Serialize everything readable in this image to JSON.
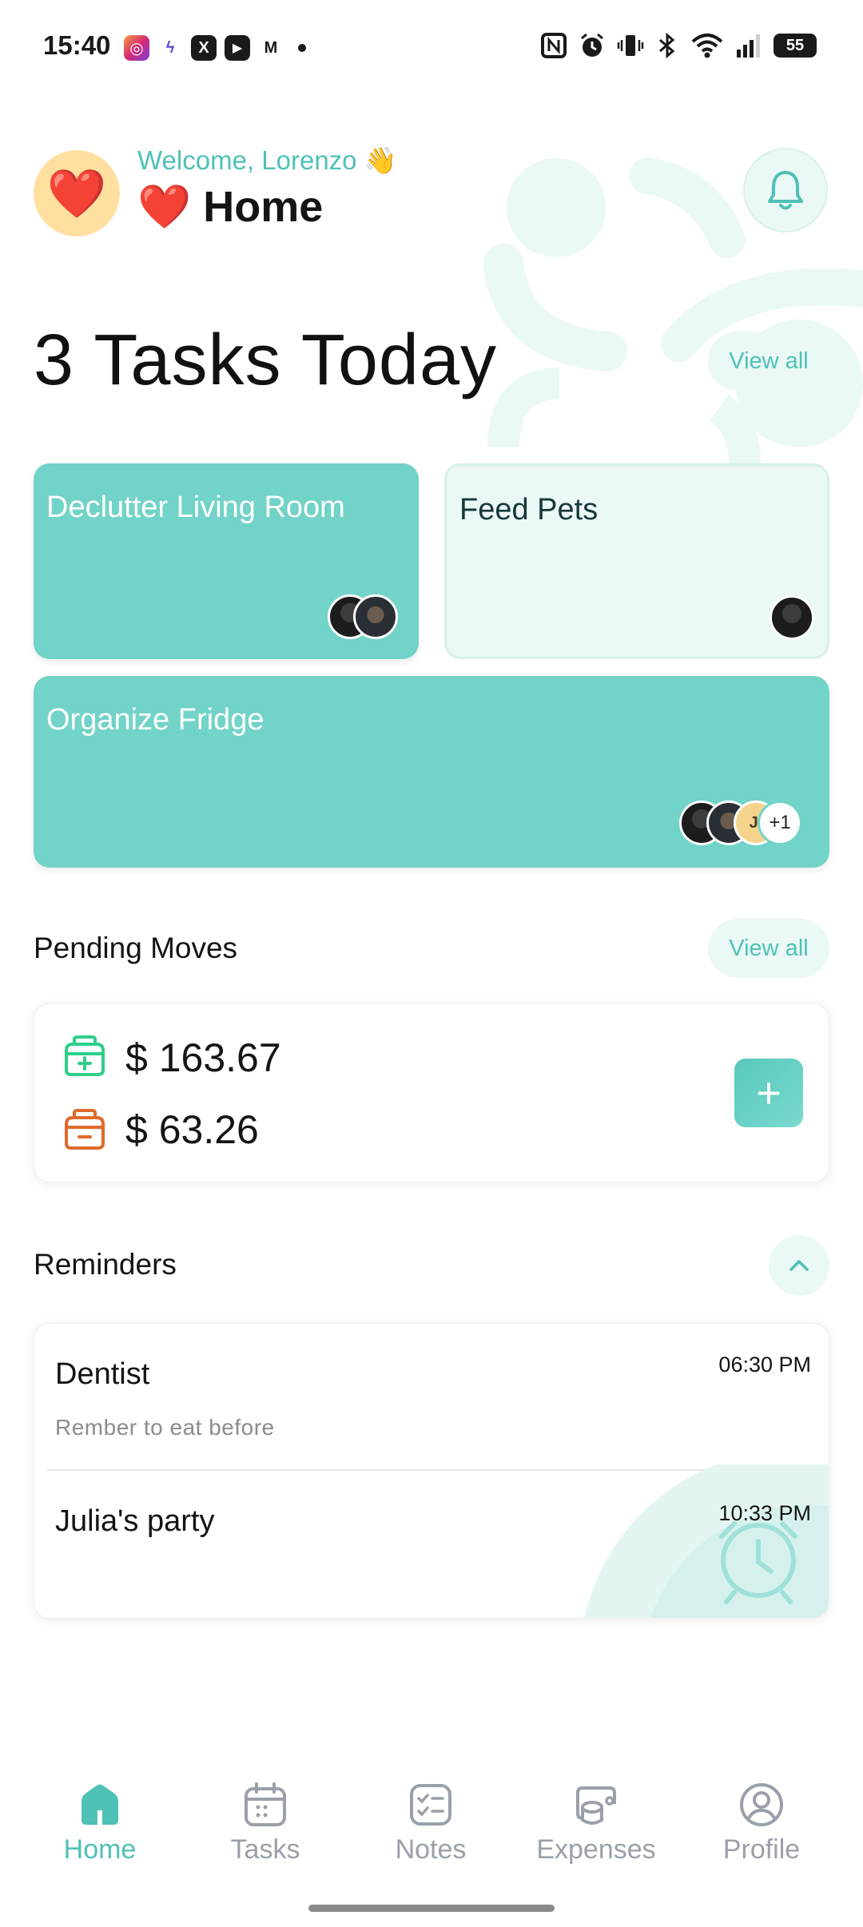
{
  "status_bar": {
    "time": "15:40",
    "battery": "55",
    "apps": [
      "instagram-icon",
      "messenger-icon",
      "x-icon",
      "youtube-icon",
      "gmail-icon"
    ],
    "system": [
      "nfc-icon",
      "alarm-icon",
      "vibrate-icon",
      "bluetooth-icon",
      "wifi-icon",
      "signal-icon"
    ]
  },
  "header": {
    "avatar_emoji": "❤️",
    "welcome": "Welcome, Lorenzo 👋",
    "title": "❤️ Home"
  },
  "tasks": {
    "heading": "3 Tasks Today",
    "view_all": "View all",
    "items": [
      {
        "title": "Declutter Living Room",
        "assignees": [
          "photo",
          "photo"
        ]
      },
      {
        "title": "Feed Pets",
        "assignees": [
          "photo"
        ]
      },
      {
        "title": "Organize Fridge",
        "assignees": [
          "photo",
          "photo",
          "JI"
        ],
        "more": "+1"
      }
    ]
  },
  "pending_moves": {
    "title": "Pending Moves",
    "view_all": "View all",
    "incoming": "$ 163.67",
    "outgoing": "$ 63.26",
    "add_label": "+"
  },
  "reminders": {
    "title": "Reminders",
    "items": [
      {
        "title": "Dentist",
        "time": "06:30 PM",
        "note": "Rember to eat before"
      },
      {
        "title": "Julia's party",
        "time": "10:33 PM",
        "note": ""
      }
    ]
  },
  "nav": {
    "items": [
      {
        "label": "Home",
        "icon": "home-icon",
        "active": true
      },
      {
        "label": "Tasks",
        "icon": "calendar-icon",
        "active": false
      },
      {
        "label": "Notes",
        "icon": "checklist-icon",
        "active": false
      },
      {
        "label": "Expenses",
        "icon": "coins-icon",
        "active": false
      },
      {
        "label": "Profile",
        "icon": "profile-icon",
        "active": false
      }
    ]
  },
  "colors": {
    "accent": "#4fc1b6",
    "card_teal": "#72d3c8",
    "card_light": "#eaf8f6",
    "income": "#2fcf8a",
    "expense": "#e06a2c"
  }
}
